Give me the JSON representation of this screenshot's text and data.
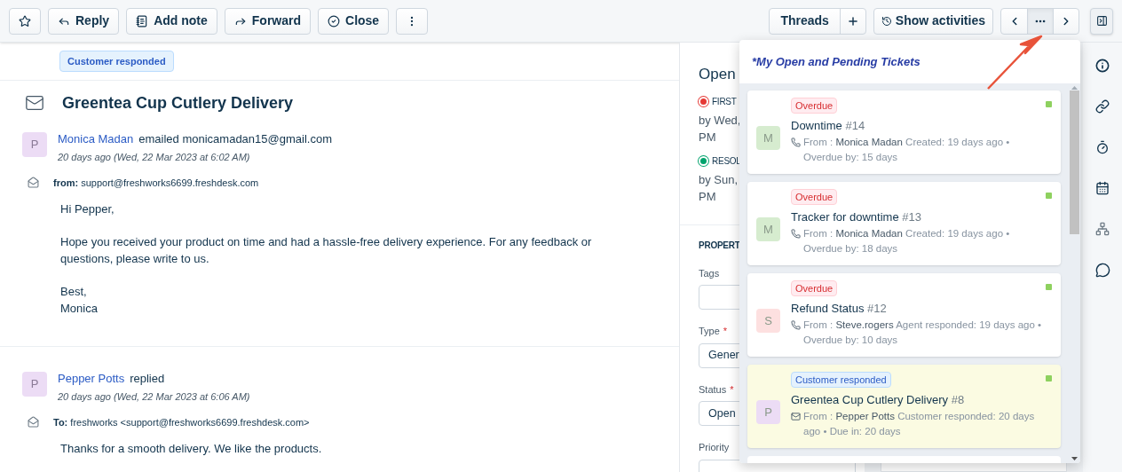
{
  "toolbar": {
    "left_buttons": [
      {
        "kind": "star"
      },
      {
        "kind": "reply",
        "label": "Reply"
      },
      {
        "kind": "note",
        "label": "Add note"
      },
      {
        "kind": "forward",
        "label": "Forward"
      },
      {
        "kind": "check",
        "label": "Close"
      },
      {
        "kind": "more"
      }
    ],
    "threads": {
      "label": "Threads"
    },
    "activities": {
      "label": "Show activities"
    },
    "nav": [
      {
        "kind": "prev",
        "selected": false
      },
      {
        "kind": "more",
        "selected": true
      },
      {
        "kind": "next",
        "selected": false
      }
    ]
  },
  "ticket": {
    "status_badge": "Customer responded",
    "title": "Greentea Cup Cutlery Delivery",
    "messages": [
      {
        "avatar": "P",
        "author": "Monica Madan",
        "action": "emailed monicamadan15@gmail.com",
        "time": "20 days ago (Wed, 22 Mar 2023 at 6:02 AM)",
        "address_label": "from:",
        "address": "support@freshworks6699.freshdesk.com",
        "body": [
          "Hi Pepper,",
          "Hope you received your product on time and had a hassle-free delivery experience. For any feedback or questions, please write to us.",
          "Best,\nMonica"
        ]
      },
      {
        "avatar": "P",
        "author": "Pepper Potts",
        "action": "replied",
        "time": "20 days ago (Wed, 22 Mar 2023 at 6:06 AM)",
        "address_label": "To:",
        "address": "freshworks <support@freshworks6699.freshdesk.com>",
        "body": [
          "Thanks for a smooth delivery. We like the products."
        ]
      }
    ]
  },
  "properties_panel": {
    "status": "Open",
    "sla": [
      {
        "label": "FIRST",
        "color": "#e53935",
        "due": "by Wed,\nPM"
      },
      {
        "label": "RESOL",
        "color": "#00a36c",
        "due": "by Sun,\nPM"
      }
    ],
    "section": "PROPERT",
    "fields": [
      {
        "label": "Tags"
      },
      {
        "label": "Type",
        "required_mark": "*",
        "value": "Gener"
      },
      {
        "label": "Status",
        "required_mark": "*",
        "value": "Open"
      },
      {
        "label": "Priority"
      }
    ]
  },
  "popup": {
    "title": "*My Open and Pending Tickets",
    "tickets": [
      {
        "tag": {
          "kind": "overdue",
          "label": "Overdue"
        },
        "avatar": "M",
        "color": "#d6eccf",
        "title": "Downtime",
        "number": "#14",
        "kind": "phone",
        "from_label": "From :",
        "sender": "Monica Madan",
        "activity": "Created: 19 days ago",
        "separator": "•",
        "due": "Overdue by: 15 days",
        "selected": false
      },
      {
        "tag": {
          "kind": "overdue",
          "label": "Overdue"
        },
        "avatar": "M",
        "color": "#d6eccf",
        "title": "Tracker for downtime",
        "number": "#13",
        "kind": "phone",
        "from_label": "From :",
        "sender": "Monica Madan",
        "activity": "Created: 19 days ago",
        "separator": "•",
        "due": "Overdue by: 18 days",
        "selected": false
      },
      {
        "tag": {
          "kind": "overdue",
          "label": "Overdue"
        },
        "avatar": "S",
        "color": "#fde0e0",
        "title": "Refund Status",
        "number": "#12",
        "kind": "phone",
        "from_label": "From :",
        "sender": "Steve.rogers",
        "activity": "Agent responded: 19 days ago",
        "separator": "•",
        "due": "Overdue by: 10 days",
        "selected": false
      },
      {
        "tag": {
          "kind": "responded",
          "label": "Customer responded"
        },
        "avatar": "P",
        "color": "#ecdcf5",
        "title": "Greentea Cup Cutlery Delivery",
        "number": "#8",
        "kind": "email",
        "from_label": "From :",
        "sender": "Pepper Potts",
        "activity": "Customer responded: 20 days ago",
        "separator": "•",
        "due": "Due in: 20 days",
        "selected": true
      }
    ]
  }
}
